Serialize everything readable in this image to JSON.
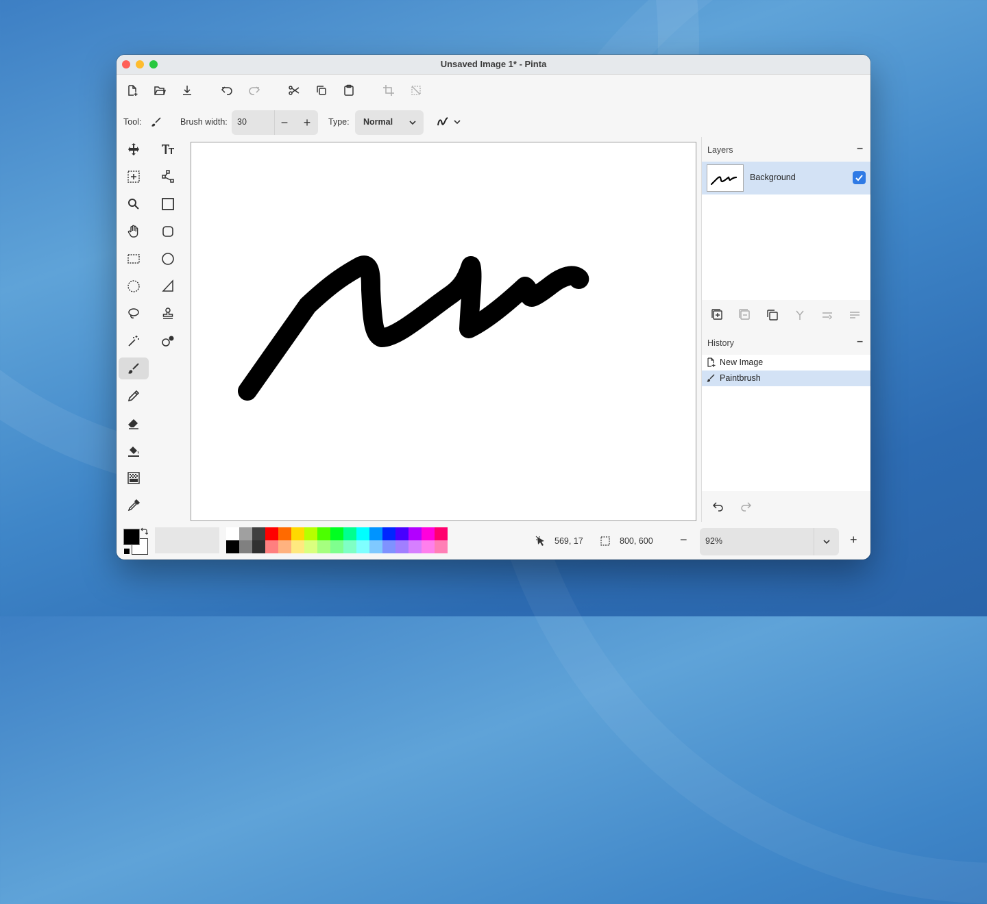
{
  "window": {
    "title": "Unsaved Image 1* - Pinta"
  },
  "toolbar": {
    "items": [
      "new-image",
      "open",
      "save",
      "undo",
      "redo",
      "cut",
      "copy",
      "paste",
      "crop",
      "deselect"
    ]
  },
  "tool_options": {
    "tool_label": "Tool:",
    "brush_width_label": "Brush width:",
    "brush_width_value": "30",
    "minus": "−",
    "plus": "+",
    "type_label": "Type:",
    "type_value": "Normal"
  },
  "tools": [
    "move-selected",
    "text",
    "move-selection",
    "bezier",
    "zoom",
    "rectangle",
    "pan",
    "rounded-rectangle",
    "rectangle-select",
    "ellipse",
    "ellipse-select",
    "freeform-shape",
    "lasso-select",
    "clone-stamp",
    "magic-wand",
    "recolor",
    "paintbrush",
    "pencil",
    "eraser",
    "paint-bucket",
    "gradient",
    "color-picker"
  ],
  "active_tool": "paintbrush",
  "layers": {
    "title": "Layers",
    "collapse": "–",
    "items": [
      {
        "name": "Background",
        "visible": true
      }
    ]
  },
  "history": {
    "title": "History",
    "collapse": "–",
    "items": [
      {
        "label": "New Image",
        "icon": "new-image-icon"
      },
      {
        "label": "Paintbrush",
        "icon": "paintbrush-icon"
      }
    ],
    "selected": "Paintbrush"
  },
  "status": {
    "cursor_position": "569, 17",
    "selection_size": "800, 600",
    "zoom": "92%",
    "zoom_out": "−",
    "zoom_in": "+"
  },
  "palette": {
    "primary": "#000000",
    "secondary": "#ffffff",
    "top_row": [
      "#ffffff",
      "#a0a0a0",
      "#404040",
      "#ff0000",
      "#ff6a00",
      "#ffd800",
      "#b6ff00",
      "#4cff00",
      "#00ff21",
      "#00ff90",
      "#00ffff",
      "#0094ff",
      "#0026ff",
      "#4800ff",
      "#b200ff",
      "#ff00dc",
      "#ff006e"
    ],
    "bottom_row": [
      "#000000",
      "#808080",
      "#303030",
      "#ff7f7f",
      "#ffb27f",
      "#ffe97f",
      "#daff7f",
      "#a5ff7f",
      "#7fff8e",
      "#7fffc5",
      "#7fffff",
      "#7fc9ff",
      "#7f92ff",
      "#a17fff",
      "#d67fff",
      "#ff7fed",
      "#ff7fb6"
    ]
  },
  "colors": {
    "accent": "#2f7ae5",
    "selection": "#d3e2f5"
  }
}
